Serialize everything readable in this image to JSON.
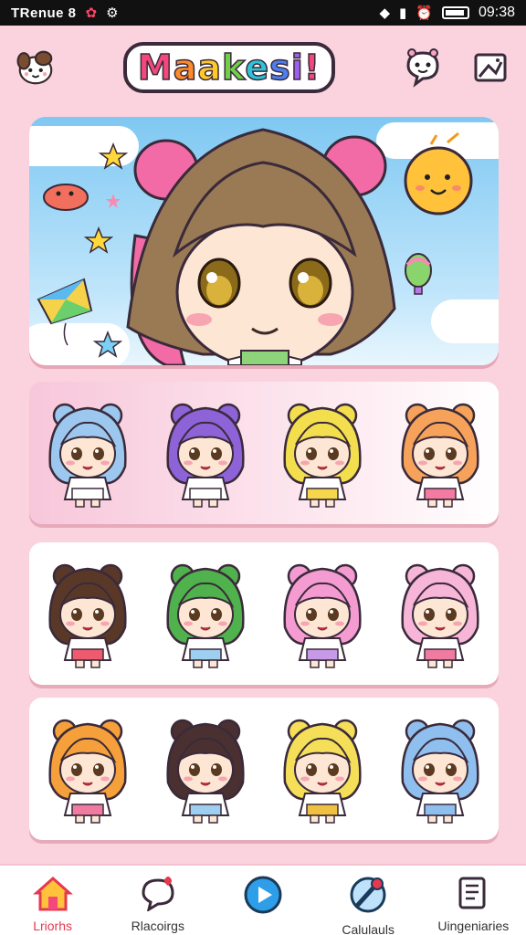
{
  "status_bar": {
    "carrier": "TRenue 8",
    "time": "09:38"
  },
  "header": {
    "title_letters": [
      "M",
      "a",
      "a",
      "k",
      "e",
      "s",
      "i",
      "!"
    ],
    "title_colors": [
      "#f5477b",
      "#ff8a2b",
      "#ffc928",
      "#6fcf46",
      "#2fc3d8",
      "#4c7ff0",
      "#a05ff0",
      "#f5477b"
    ],
    "left_icon": "puppy-avatar-icon",
    "right_icons": [
      "chat-bubble-icon",
      "image-gallery-icon"
    ]
  },
  "hero": {
    "icon": "anime-girl-banner"
  },
  "sticker_rows": [
    {
      "style": "pink",
      "stickers": [
        {
          "icon": "blue-cat-girl-sticker",
          "hair": "#9cc7ee",
          "accent": "#ffffff"
        },
        {
          "icon": "purple-hair-girl-sticker",
          "hair": "#8e63d8",
          "accent": "#ffffff"
        },
        {
          "icon": "yellow-bear-girl-sticker",
          "hair": "#f3df4e",
          "accent": "#f6d64a"
        },
        {
          "icon": "orange-hair-girl-sticker",
          "hair": "#f6a25a",
          "accent": "#f37aa0"
        }
      ]
    },
    {
      "style": "white",
      "stickers": [
        {
          "icon": "brown-bear-girl-sticker",
          "hair": "#5a3828",
          "accent": "#ef5b6e"
        },
        {
          "icon": "green-cat-girl-sticker",
          "hair": "#4fb24d",
          "accent": "#9ecff0"
        },
        {
          "icon": "pink-hair-girl-sticker",
          "hair": "#f49cd2",
          "accent": "#c79ae8"
        },
        {
          "icon": "light-pink-hair-girl-sticker",
          "hair": "#f7b5d8",
          "accent": "#f07ba1"
        }
      ]
    },
    {
      "style": "white",
      "stickers": [
        {
          "icon": "orange-bear-girl-sticker",
          "hair": "#f5a03a",
          "accent": "#f07ba1"
        },
        {
          "icon": "dark-bear-girl-sticker",
          "hair": "#4a3030",
          "accent": "#9ecff0"
        },
        {
          "icon": "rainbow-hair-girl-sticker",
          "hair": "#f5df58",
          "accent": "#f0c040"
        },
        {
          "icon": "blue-hood-girl-sticker",
          "hair": "#8fbfef",
          "accent": "#8fbfef"
        }
      ]
    }
  ],
  "bottom_nav": [
    {
      "label": "Lriorhs",
      "icon": "home-icon",
      "active": true
    },
    {
      "label": "Rlacoirgs",
      "icon": "chat-heart-icon",
      "active": false
    },
    {
      "label": "",
      "icon": "play-circle-icon",
      "active": false
    },
    {
      "label": "Calulauls",
      "icon": "palette-brush-icon",
      "active": false
    },
    {
      "label": "Uingeniaries",
      "icon": "notebook-icon",
      "active": false
    }
  ]
}
